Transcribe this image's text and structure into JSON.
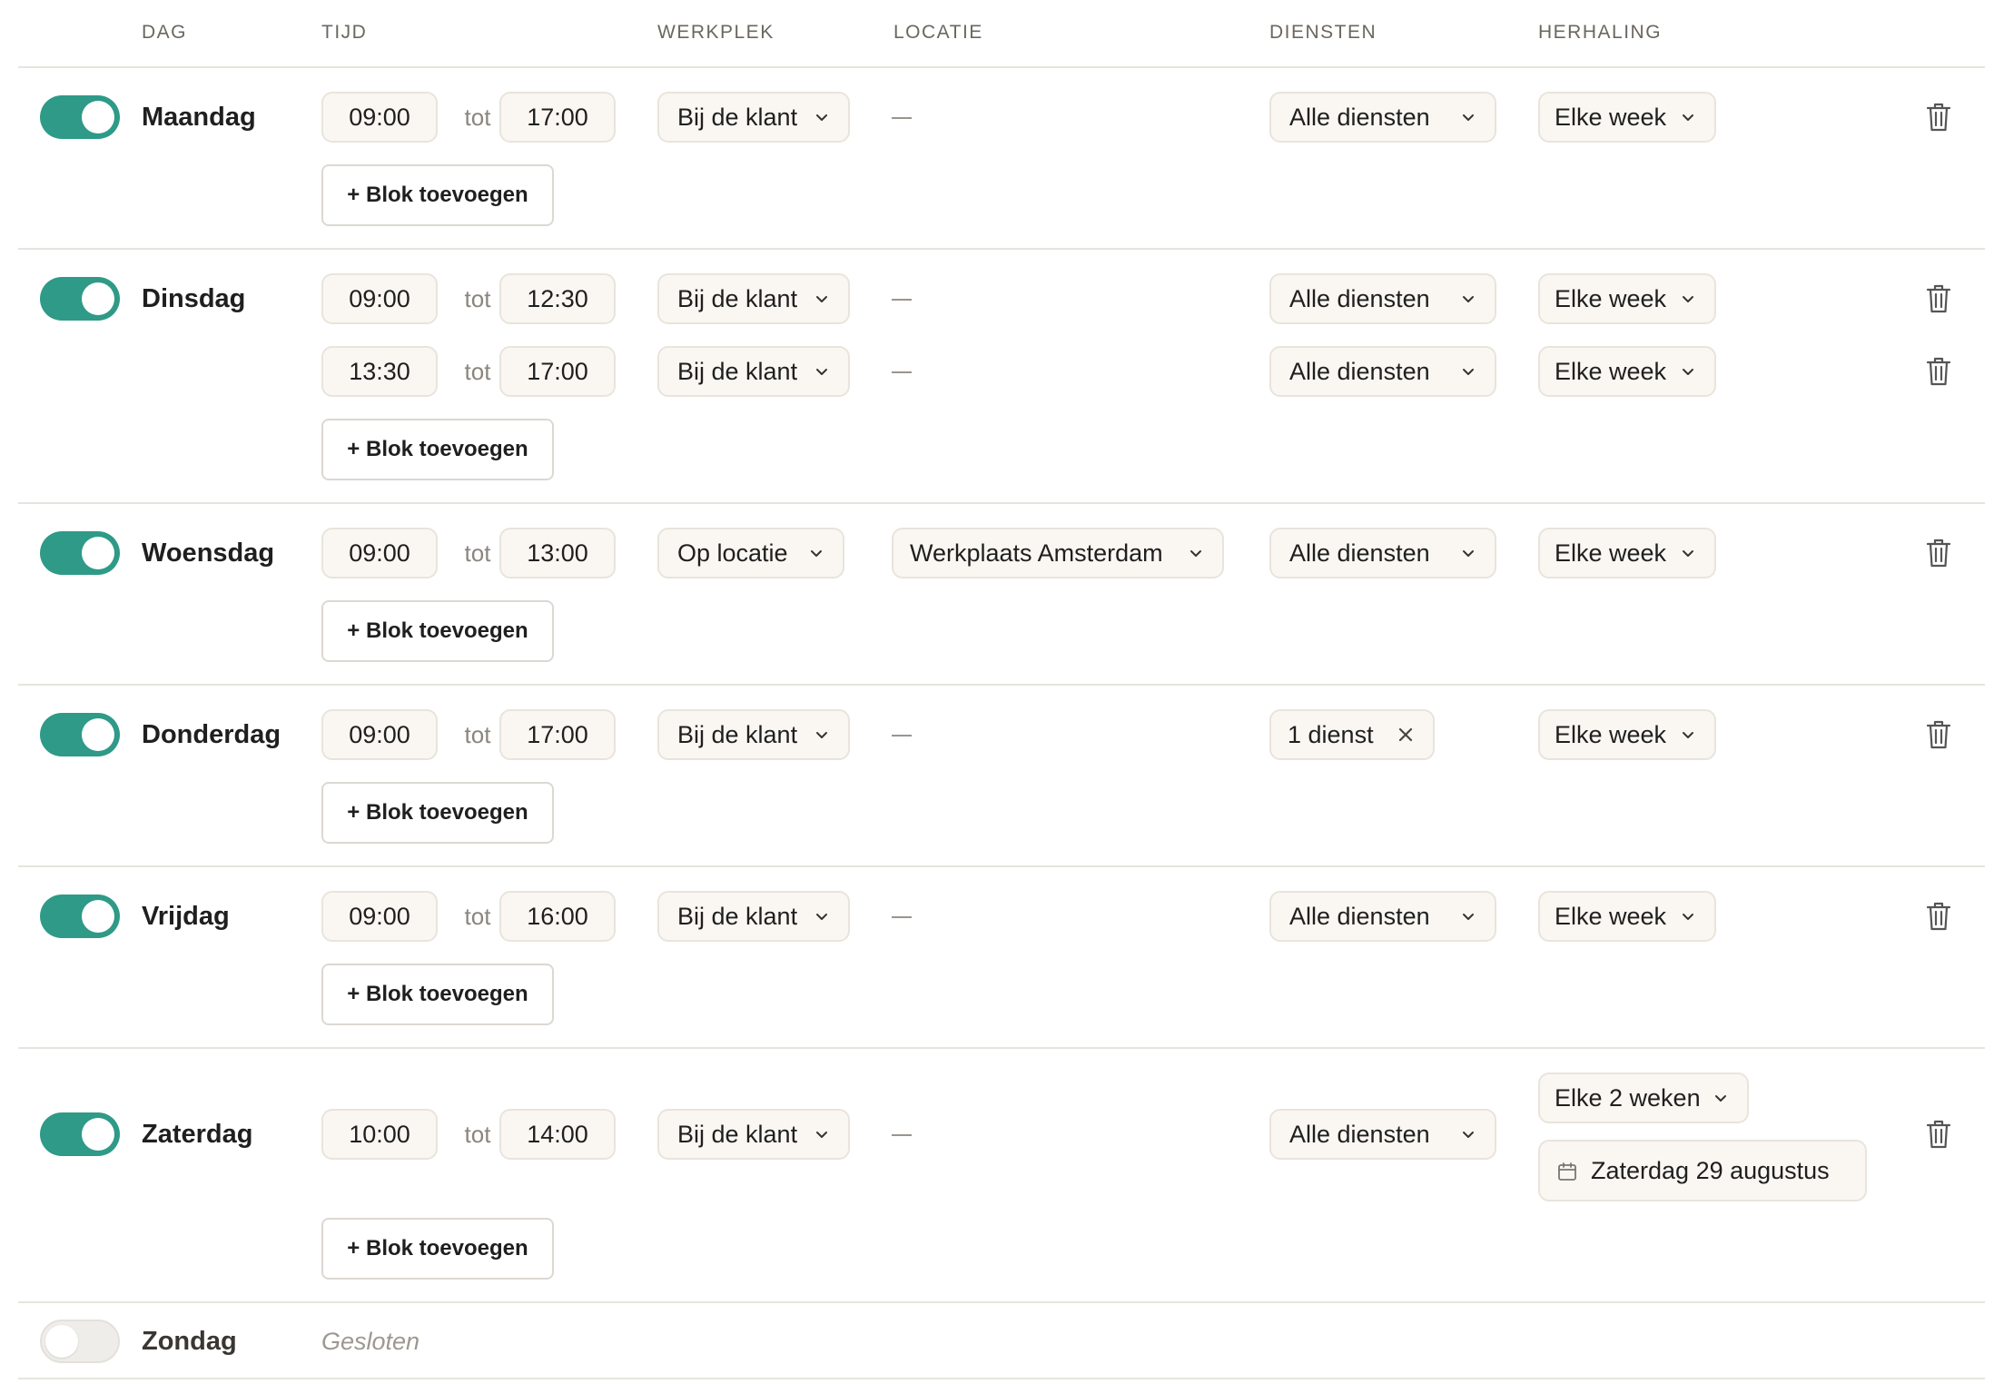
{
  "columns": {
    "day": "DAG",
    "time": "TIJD",
    "workplace": "WERKPLEK",
    "location": "LOCATIE",
    "services": "DIENSTEN",
    "repeat": "HERHALING"
  },
  "icons": {
    "chevron": "chevron-down-icon",
    "delete": "trash-icon",
    "clear": "close-icon",
    "date": "calendar-icon"
  },
  "colors": {
    "toggle_on": "#2e9a87",
    "toggle_off": "#efede9",
    "field_bg": "#faf7f2"
  },
  "labels": {
    "to": "tot",
    "add_block": "+ Blok toevoegen",
    "no_location": "—"
  },
  "days": [
    {
      "name": "Maandag",
      "enabled": true,
      "blocks": [
        {
          "start": "09:00",
          "end": "17:00",
          "workplace": "Bij de klant",
          "services": "Alle diensten",
          "repeat": "Elke week"
        }
      ]
    },
    {
      "name": "Dinsdag",
      "enabled": true,
      "blocks": [
        {
          "start": "09:00",
          "end": "12:30",
          "workplace": "Bij de klant",
          "services": "Alle diensten",
          "repeat": "Elke week"
        },
        {
          "start": "13:30",
          "end": "17:00",
          "workplace": "Bij de klant",
          "services": "Alle diensten",
          "repeat": "Elke week"
        }
      ]
    },
    {
      "name": "Woensdag",
      "enabled": true,
      "blocks": [
        {
          "start": "09:00",
          "end": "13:00",
          "workplace": "Op locatie",
          "location": "Werkplaats Amsterdam",
          "services": "Alle diensten",
          "repeat": "Elke week"
        }
      ]
    },
    {
      "name": "Donderdag",
      "enabled": true,
      "blocks": [
        {
          "start": "09:00",
          "end": "17:00",
          "workplace": "Bij de klant",
          "services": "1 dienst",
          "repeat": "Elke week"
        }
      ]
    },
    {
      "name": "Vrijdag",
      "enabled": true,
      "blocks": [
        {
          "start": "09:00",
          "end": "16:00",
          "workplace": "Bij de klant",
          "services": "Alle diensten",
          "repeat": "Elke week"
        }
      ]
    },
    {
      "name": "Zaterdag",
      "enabled": true,
      "blocks": [
        {
          "start": "10:00",
          "end": "14:00",
          "workplace": "Bij de klant",
          "services": "Alle diensten",
          "repeat": "Elke 2 weken",
          "start_date": "Zaterdag 29 augustus"
        }
      ]
    },
    {
      "name": "Zondag",
      "enabled": false,
      "status": "Gesloten",
      "blocks": []
    }
  ]
}
